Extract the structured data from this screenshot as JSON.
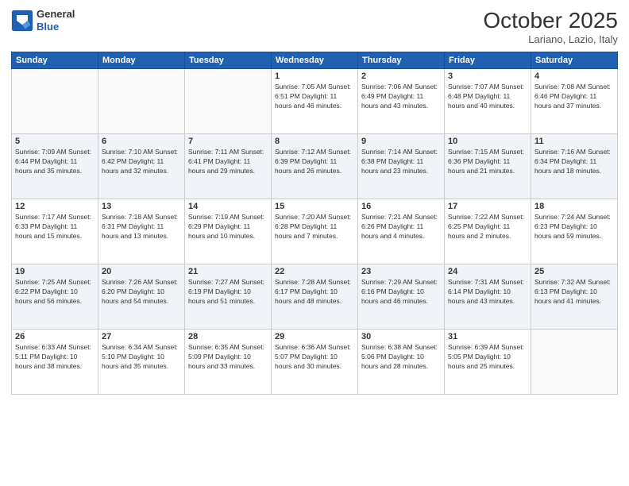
{
  "header": {
    "logo_line1": "General",
    "logo_line2": "Blue",
    "month": "October 2025",
    "location": "Lariano, Lazio, Italy"
  },
  "weekdays": [
    "Sunday",
    "Monday",
    "Tuesday",
    "Wednesday",
    "Thursday",
    "Friday",
    "Saturday"
  ],
  "weeks": [
    [
      {
        "day": "",
        "info": ""
      },
      {
        "day": "",
        "info": ""
      },
      {
        "day": "",
        "info": ""
      },
      {
        "day": "1",
        "info": "Sunrise: 7:05 AM\nSunset: 6:51 PM\nDaylight: 11 hours\nand 46 minutes."
      },
      {
        "day": "2",
        "info": "Sunrise: 7:06 AM\nSunset: 6:49 PM\nDaylight: 11 hours\nand 43 minutes."
      },
      {
        "day": "3",
        "info": "Sunrise: 7:07 AM\nSunset: 6:48 PM\nDaylight: 11 hours\nand 40 minutes."
      },
      {
        "day": "4",
        "info": "Sunrise: 7:08 AM\nSunset: 6:46 PM\nDaylight: 11 hours\nand 37 minutes."
      }
    ],
    [
      {
        "day": "5",
        "info": "Sunrise: 7:09 AM\nSunset: 6:44 PM\nDaylight: 11 hours\nand 35 minutes."
      },
      {
        "day": "6",
        "info": "Sunrise: 7:10 AM\nSunset: 6:42 PM\nDaylight: 11 hours\nand 32 minutes."
      },
      {
        "day": "7",
        "info": "Sunrise: 7:11 AM\nSunset: 6:41 PM\nDaylight: 11 hours\nand 29 minutes."
      },
      {
        "day": "8",
        "info": "Sunrise: 7:12 AM\nSunset: 6:39 PM\nDaylight: 11 hours\nand 26 minutes."
      },
      {
        "day": "9",
        "info": "Sunrise: 7:14 AM\nSunset: 6:38 PM\nDaylight: 11 hours\nand 23 minutes."
      },
      {
        "day": "10",
        "info": "Sunrise: 7:15 AM\nSunset: 6:36 PM\nDaylight: 11 hours\nand 21 minutes."
      },
      {
        "day": "11",
        "info": "Sunrise: 7:16 AM\nSunset: 6:34 PM\nDaylight: 11 hours\nand 18 minutes."
      }
    ],
    [
      {
        "day": "12",
        "info": "Sunrise: 7:17 AM\nSunset: 6:33 PM\nDaylight: 11 hours\nand 15 minutes."
      },
      {
        "day": "13",
        "info": "Sunrise: 7:18 AM\nSunset: 6:31 PM\nDaylight: 11 hours\nand 13 minutes."
      },
      {
        "day": "14",
        "info": "Sunrise: 7:19 AM\nSunset: 6:29 PM\nDaylight: 11 hours\nand 10 minutes."
      },
      {
        "day": "15",
        "info": "Sunrise: 7:20 AM\nSunset: 6:28 PM\nDaylight: 11 hours\nand 7 minutes."
      },
      {
        "day": "16",
        "info": "Sunrise: 7:21 AM\nSunset: 6:26 PM\nDaylight: 11 hours\nand 4 minutes."
      },
      {
        "day": "17",
        "info": "Sunrise: 7:22 AM\nSunset: 6:25 PM\nDaylight: 11 hours\nand 2 minutes."
      },
      {
        "day": "18",
        "info": "Sunrise: 7:24 AM\nSunset: 6:23 PM\nDaylight: 10 hours\nand 59 minutes."
      }
    ],
    [
      {
        "day": "19",
        "info": "Sunrise: 7:25 AM\nSunset: 6:22 PM\nDaylight: 10 hours\nand 56 minutes."
      },
      {
        "day": "20",
        "info": "Sunrise: 7:26 AM\nSunset: 6:20 PM\nDaylight: 10 hours\nand 54 minutes."
      },
      {
        "day": "21",
        "info": "Sunrise: 7:27 AM\nSunset: 6:19 PM\nDaylight: 10 hours\nand 51 minutes."
      },
      {
        "day": "22",
        "info": "Sunrise: 7:28 AM\nSunset: 6:17 PM\nDaylight: 10 hours\nand 48 minutes."
      },
      {
        "day": "23",
        "info": "Sunrise: 7:29 AM\nSunset: 6:16 PM\nDaylight: 10 hours\nand 46 minutes."
      },
      {
        "day": "24",
        "info": "Sunrise: 7:31 AM\nSunset: 6:14 PM\nDaylight: 10 hours\nand 43 minutes."
      },
      {
        "day": "25",
        "info": "Sunrise: 7:32 AM\nSunset: 6:13 PM\nDaylight: 10 hours\nand 41 minutes."
      }
    ],
    [
      {
        "day": "26",
        "info": "Sunrise: 6:33 AM\nSunset: 5:11 PM\nDaylight: 10 hours\nand 38 minutes."
      },
      {
        "day": "27",
        "info": "Sunrise: 6:34 AM\nSunset: 5:10 PM\nDaylight: 10 hours\nand 35 minutes."
      },
      {
        "day": "28",
        "info": "Sunrise: 6:35 AM\nSunset: 5:09 PM\nDaylight: 10 hours\nand 33 minutes."
      },
      {
        "day": "29",
        "info": "Sunrise: 6:36 AM\nSunset: 5:07 PM\nDaylight: 10 hours\nand 30 minutes."
      },
      {
        "day": "30",
        "info": "Sunrise: 6:38 AM\nSunset: 5:06 PM\nDaylight: 10 hours\nand 28 minutes."
      },
      {
        "day": "31",
        "info": "Sunrise: 6:39 AM\nSunset: 5:05 PM\nDaylight: 10 hours\nand 25 minutes."
      },
      {
        "day": "",
        "info": ""
      }
    ]
  ]
}
